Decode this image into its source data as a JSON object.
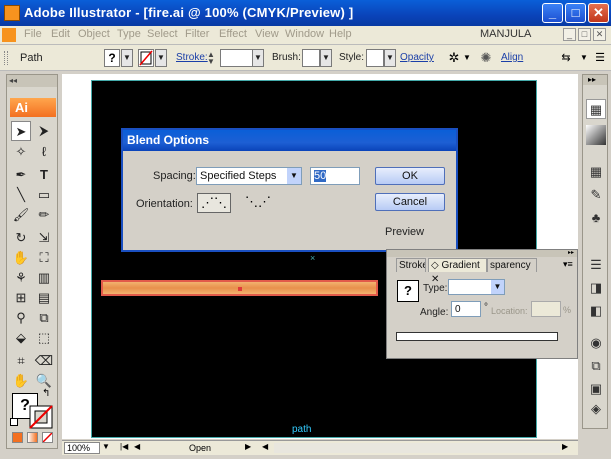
{
  "window": {
    "title": "Adobe Illustrator - [fire.ai @ 100% (CMYK/Preview) ]",
    "minimize": "_",
    "maximize": "□",
    "close": "✕"
  },
  "menubar": {
    "items": [
      "File",
      "Edit",
      "Object",
      "Type",
      "Select",
      "Filter",
      "Effect",
      "View",
      "Window",
      "Help"
    ],
    "user": "MANJULA",
    "mdi_buttons": [
      "_",
      "□",
      "✕"
    ]
  },
  "controlbar": {
    "selection_label": "Path",
    "fill_swatch": "?",
    "stroke_link": "Stroke:",
    "brush_label": "Brush:",
    "style_label": "Style:",
    "opacity_link": "Opacity",
    "align_link": "Align"
  },
  "tools": {
    "badge": "Ai",
    "fill_unknown": "?"
  },
  "blend_dialog": {
    "title": "Blend Options",
    "spacing_label": "Spacing:",
    "spacing_value": "Specified Steps",
    "steps_value": "50",
    "orientation_label": "Orientation:",
    "ok": "OK",
    "cancel": "Cancel",
    "preview": "Preview"
  },
  "gradient_panel": {
    "tabs": [
      "Stroke",
      "Gradient",
      "sparency"
    ],
    "active_tab": "Gradient",
    "swatch": "?",
    "type_label": "Type:",
    "angle_label": "Angle:",
    "angle_value": "0",
    "degree": "°",
    "location_label": "Location:",
    "percent": "%"
  },
  "canvas": {
    "path_hint": "path",
    "center_marker": "×"
  },
  "statusbar": {
    "zoom": "100%",
    "status": "Open"
  },
  "colors": {
    "accent": "#f37021",
    "titlebar": "#0a43b9",
    "blend_bar": "#e8a060"
  }
}
